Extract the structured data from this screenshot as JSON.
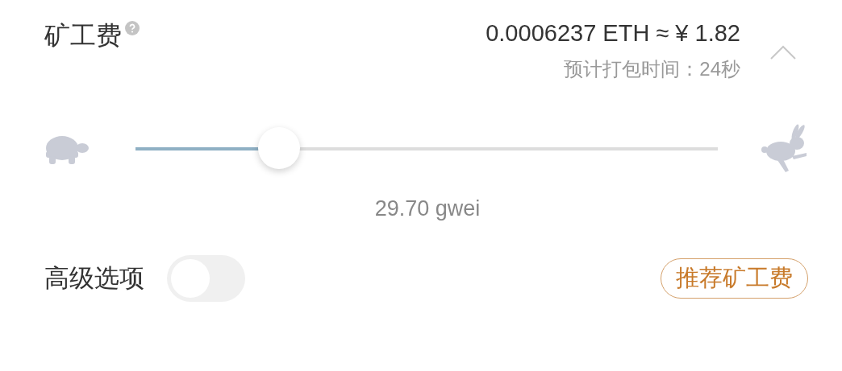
{
  "header": {
    "title": "矿工费",
    "amount": "0.0006237 ETH ≈ ¥ 1.82",
    "estimate": "预计打包时间：24秒",
    "expanded": true
  },
  "slider": {
    "level": 0.247,
    "reading": "29.70 gwei"
  },
  "advanced": {
    "label": "高级选项",
    "on": false
  },
  "recommend_button": "推荐矿工费"
}
